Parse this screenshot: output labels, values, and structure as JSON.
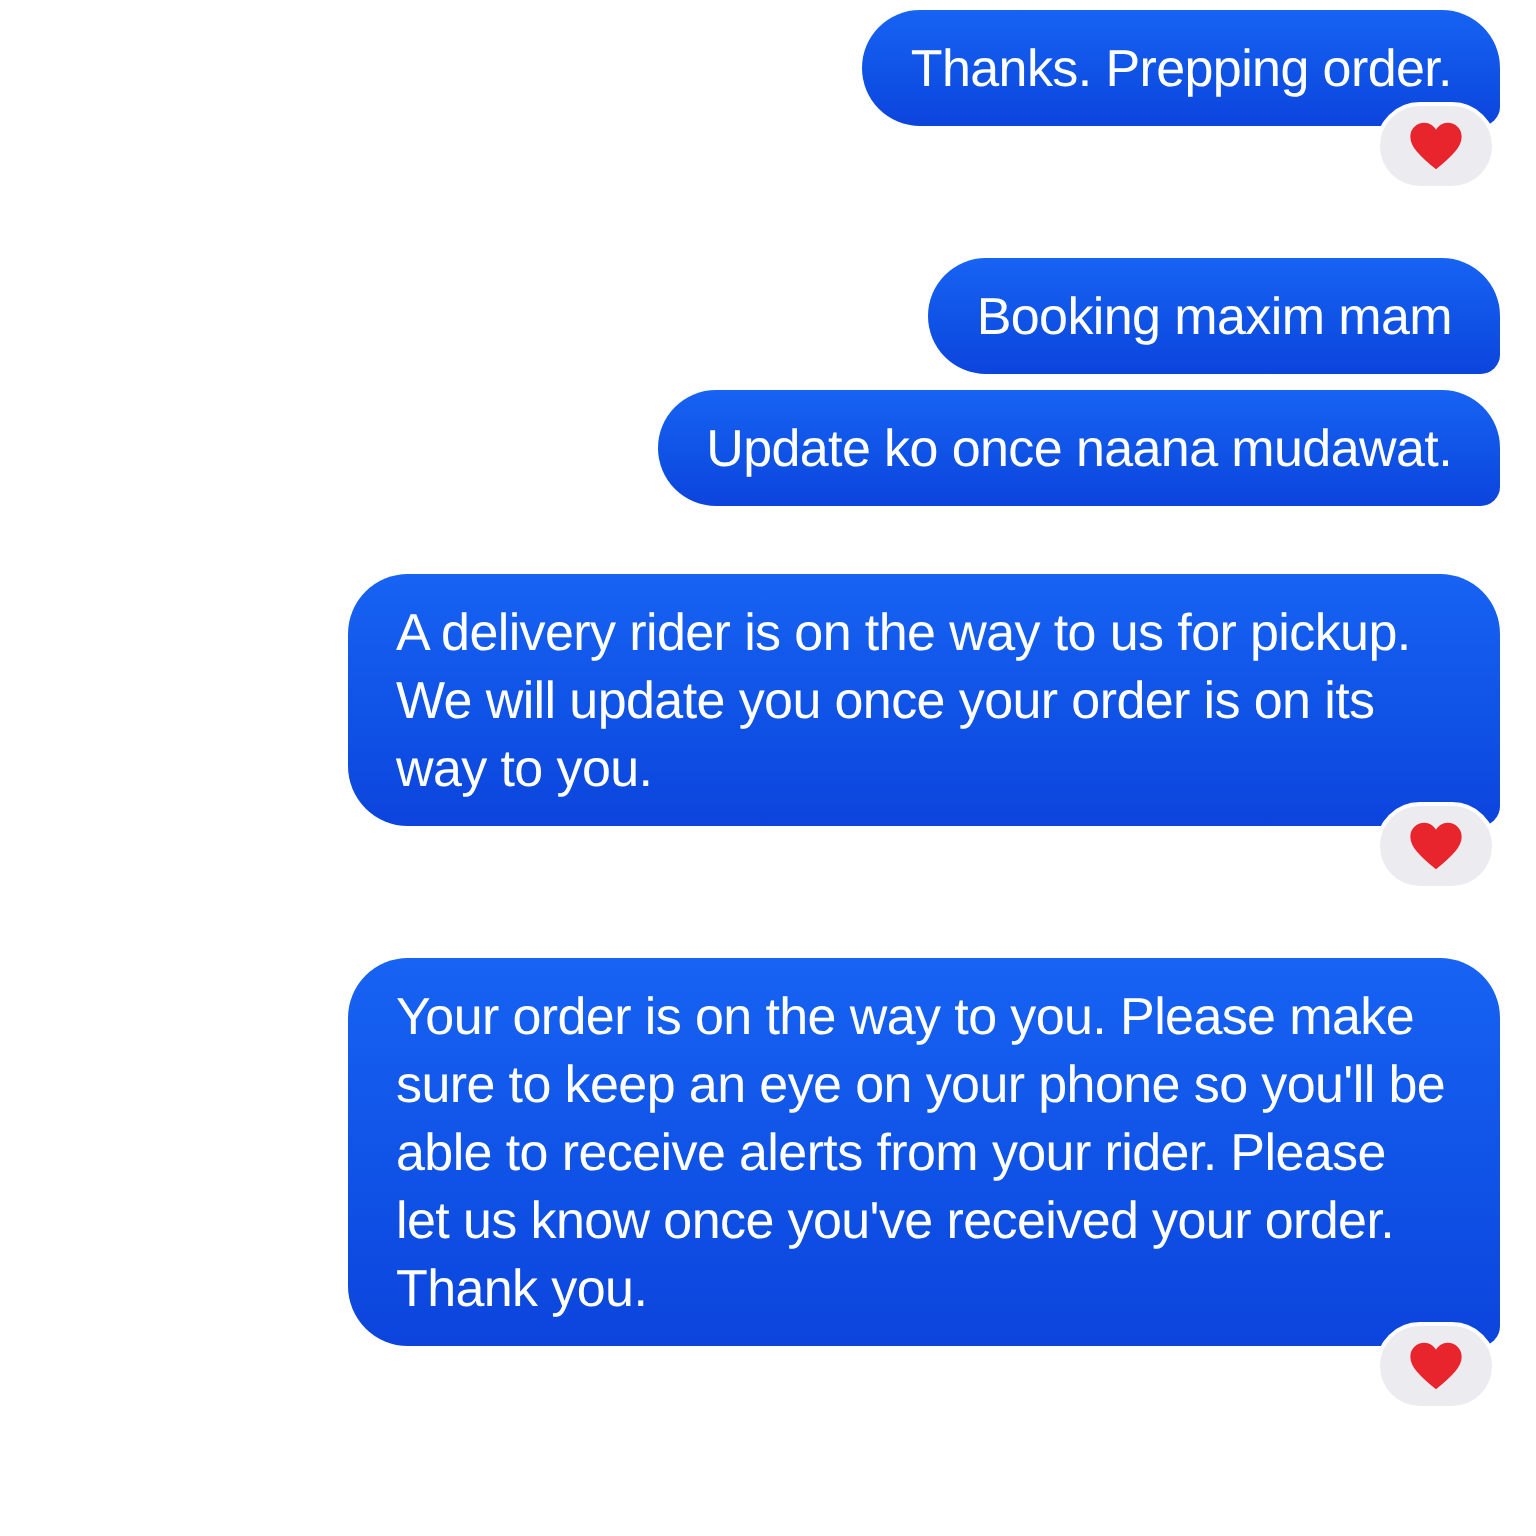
{
  "groups": [
    {
      "messages": [
        {
          "text": "Thanks. Prepping order.",
          "hearted": true
        }
      ]
    },
    {
      "messages": [
        {
          "text": "Booking maxim mam",
          "hearted": false
        },
        {
          "text": "Update ko once naana mudawat.",
          "hearted": false
        }
      ]
    },
    {
      "messages": [
        {
          "text": "A delivery rider is on the way to us for pickup. We will update you once your order is on its way to you.",
          "hearted": true
        }
      ]
    },
    {
      "messages": [
        {
          "text": "Your order is on the way to you. Please make sure to keep an eye on your phone so you'll be able to receive alerts from your rider. Please let us know once you've received your order. Thank you.",
          "hearted": true
        }
      ]
    }
  ]
}
